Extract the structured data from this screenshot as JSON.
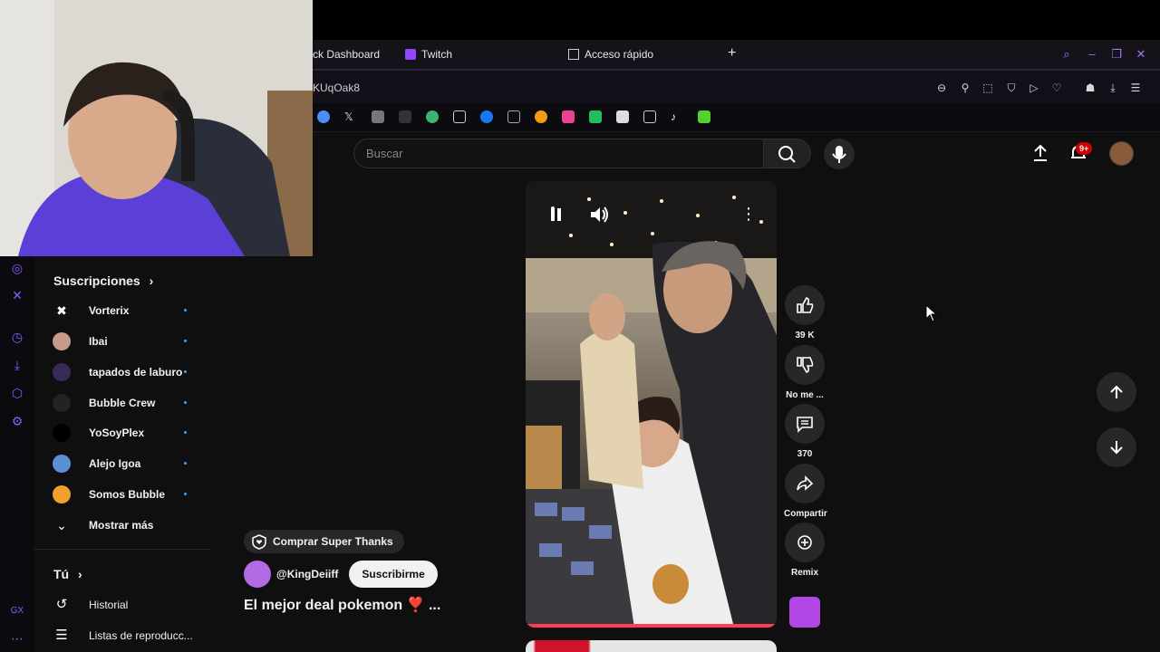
{
  "browser": {
    "tabs": [
      {
        "label": "ck Dashboard"
      },
      {
        "label": "Twitch"
      },
      {
        "label": "Acceso rápido"
      }
    ],
    "address": "KUqOak8"
  },
  "search": {
    "placeholder": "Buscar"
  },
  "notifications": {
    "badge": "9+"
  },
  "sidebar": {
    "subscriptions_title": "Suscripciones",
    "subscriptions": [
      {
        "name": "Vorterix",
        "color": "#111111"
      },
      {
        "name": "Ibai",
        "color": "#c89a8a"
      },
      {
        "name": "tapados de laburo",
        "color": "#3a2a5a"
      },
      {
        "name": "Bubble Crew",
        "color": "#222222"
      },
      {
        "name": "YoSoyPlex",
        "color": "#000000"
      },
      {
        "name": "Alejo Igoa",
        "color": "#5a8fd6"
      },
      {
        "name": "Somos Bubble",
        "color": "#f0a030"
      }
    ],
    "show_more": "Mostrar más",
    "you_title": "Tú",
    "history": "Historial",
    "playlists": "Listas de reproducc..."
  },
  "short": {
    "actions": {
      "likes": "39 K",
      "dislike": "No me ...",
      "comments": "370",
      "share": "Compartir",
      "remix": "Remix"
    },
    "super_thanks": "Comprar Super Thanks",
    "channel": "@KingDeiiff",
    "subscribe": "Suscribirme",
    "title": "El mejor deal pokemon ❣️ ..."
  },
  "colors": {
    "accent": "#a970ff",
    "badge": "#cc0000",
    "dot": "#3ea6ff"
  }
}
